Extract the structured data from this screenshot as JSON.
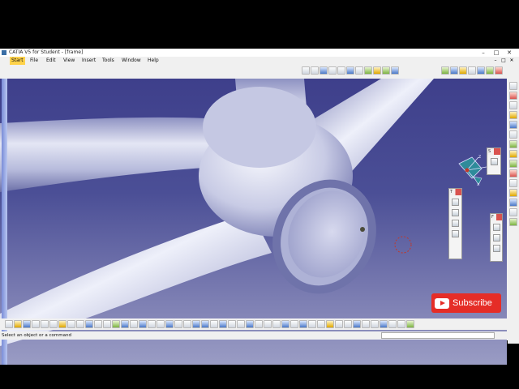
{
  "window": {
    "title": "CATIA V5 for Student - [frame]",
    "controls": [
      "–",
      "□",
      "✕"
    ],
    "mdi_controls": [
      "–",
      "□",
      "✕"
    ]
  },
  "menubar": {
    "items": [
      "Start",
      "File",
      "Edit",
      "View",
      "Insert",
      "Tools",
      "Window",
      "Help"
    ]
  },
  "floating_toolbars": {
    "sketch": {
      "title": "S"
    },
    "tools": {
      "title": "T"
    },
    "feature": {
      "title": "F"
    }
  },
  "compass": {
    "x_label": "x",
    "y_label": "y",
    "z_label": "z"
  },
  "subscribe": {
    "label": "Subscribe"
  },
  "statusbar": {
    "message": "Select an object or a command",
    "command_value": ""
  },
  "colors": {
    "accent": "#ffd24a",
    "background_top": "#3e3f8b",
    "background_bottom": "#9a9cc4",
    "part_color": "#c9cde6",
    "subscribe_red": "#e52d27"
  }
}
